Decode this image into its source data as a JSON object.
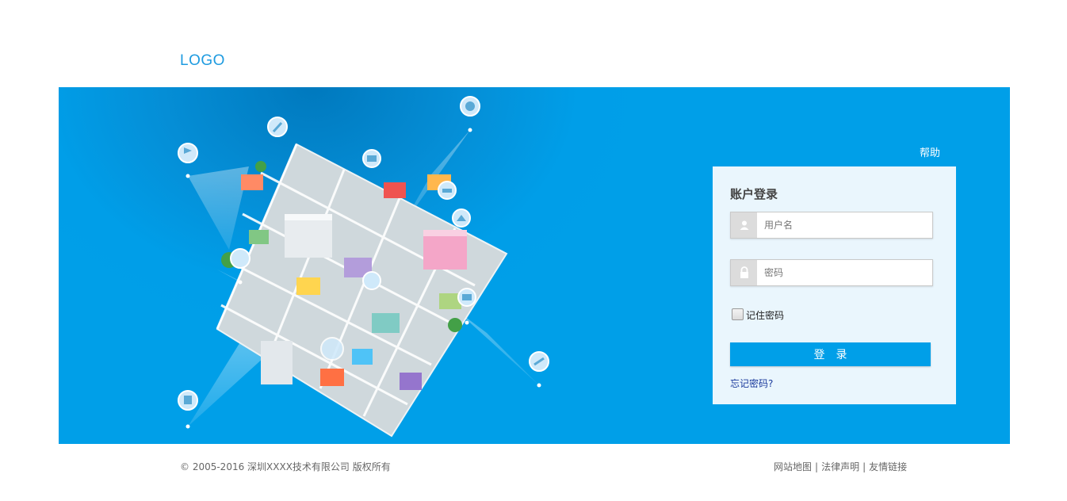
{
  "header": {
    "logo_text": "LOGO"
  },
  "banner": {
    "help_label": "帮助",
    "colors": {
      "background": "#009fe8",
      "accent_dark": "#0079be"
    },
    "pins": [
      "flag-icon",
      "wrench-icon",
      "smiley-icon",
      "book-icon",
      "car-icon",
      "home-icon",
      "running-icon",
      "cart-icon",
      "camera-icon",
      "plane-icon",
      "bus-icon",
      "globe-icon"
    ]
  },
  "login": {
    "title": "账户登录",
    "username_placeholder": "用户名",
    "password_placeholder": "密码",
    "remember_label": "记住密码",
    "submit_label": "登录",
    "forgot_label": "忘记密码?"
  },
  "footer": {
    "copyright": "© 2005-2016 深圳XXXX技术有限公司 版权所有",
    "links": [
      "网站地图",
      "法律声明",
      "友情链接"
    ]
  }
}
